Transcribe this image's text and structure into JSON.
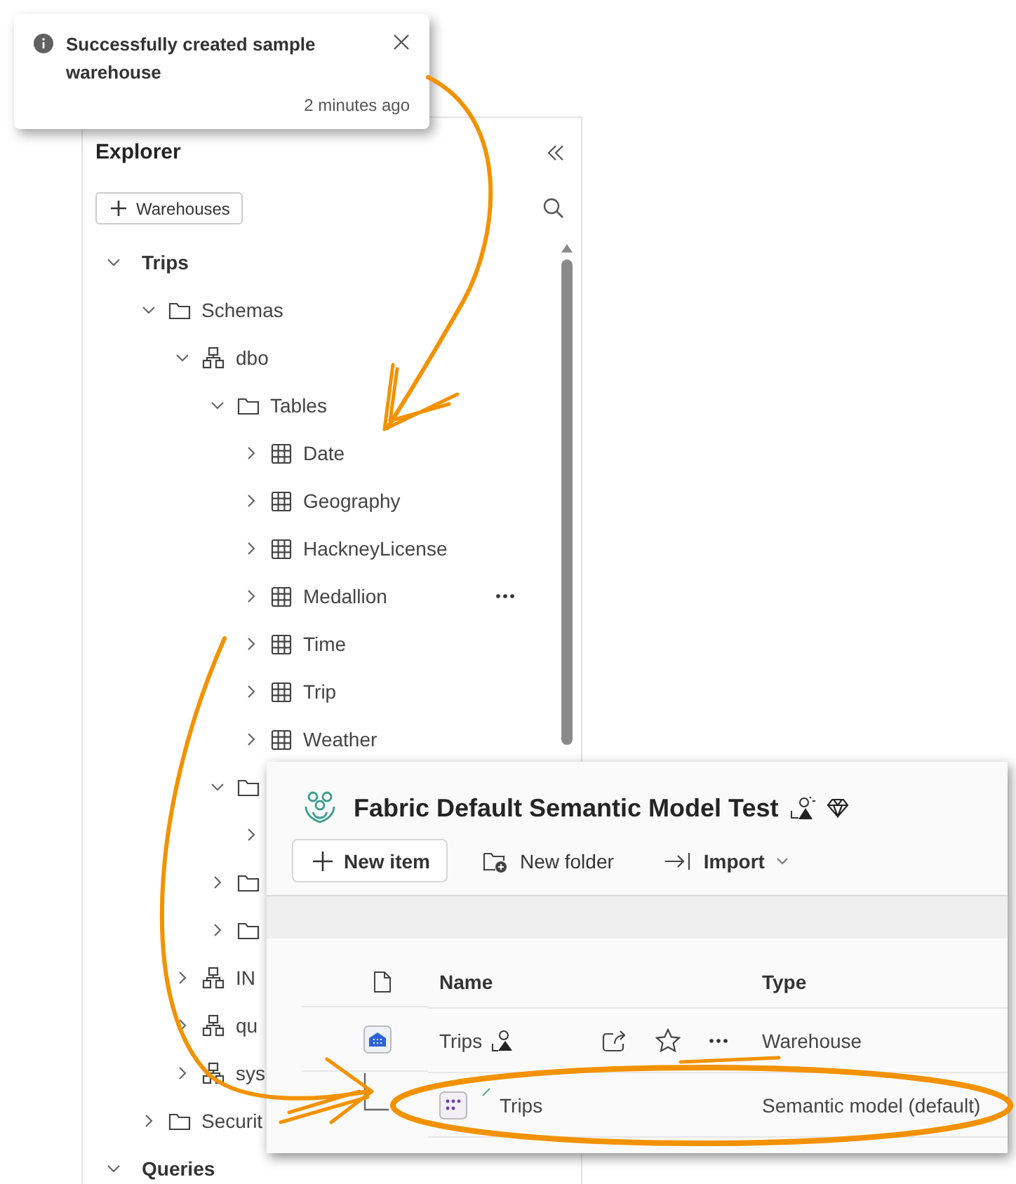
{
  "toast": {
    "message": "Successfully created sample warehouse",
    "time": "2 minutes ago"
  },
  "explorer": {
    "title": "Explorer",
    "add_button": "Warehouses",
    "tree": [
      {
        "label": "Trips",
        "kind": "root",
        "expanded": true,
        "children": [
          {
            "label": "Schemas",
            "kind": "folder",
            "expanded": true,
            "children": [
              {
                "label": "dbo",
                "kind": "schema",
                "expanded": true,
                "children": [
                  {
                    "label": "Tables",
                    "kind": "folder",
                    "expanded": true,
                    "children": [
                      {
                        "label": "Date",
                        "kind": "table",
                        "expanded": false,
                        "hovered": false
                      },
                      {
                        "label": "Geography",
                        "kind": "table",
                        "expanded": false,
                        "hovered": false
                      },
                      {
                        "label": "HackneyLicense",
                        "kind": "table",
                        "expanded": false,
                        "hovered": false
                      },
                      {
                        "label": "Medallion",
                        "kind": "table",
                        "expanded": false,
                        "hovered": true
                      },
                      {
                        "label": "Time",
                        "kind": "table",
                        "expanded": false,
                        "hovered": false
                      },
                      {
                        "label": "Trip",
                        "kind": "table",
                        "expanded": false,
                        "hovered": false
                      },
                      {
                        "label": "Weather",
                        "kind": "table",
                        "expanded": false,
                        "hovered": false
                      }
                    ]
                  },
                  {
                    "kind": "folder",
                    "expanded": true,
                    "children": [
                      {
                        "expanded": false
                      }
                    ]
                  },
                  {
                    "kind": "folder",
                    "expanded": false
                  },
                  {
                    "kind": "folder",
                    "expanded": false
                  }
                ]
              },
              {
                "label": "IN",
                "kind": "schema",
                "expanded": false
              },
              {
                "label": "qu",
                "kind": "schema",
                "expanded": false
              },
              {
                "label": "sys",
                "kind": "schema",
                "expanded": false
              }
            ]
          },
          {
            "label": "Securit",
            "kind": "folder",
            "expanded": false
          }
        ]
      },
      {
        "label": "Queries",
        "kind": "root",
        "expanded": true
      }
    ]
  },
  "workspace": {
    "title": "Fabric Default Semantic Model Test",
    "toolbar": [
      {
        "label": "New item",
        "kind": "new"
      },
      {
        "label": "New folder",
        "kind": "folder"
      },
      {
        "label": "Import",
        "kind": "import"
      }
    ],
    "columns": [
      "Name",
      "Type"
    ],
    "rows": [
      {
        "name": "Trips",
        "type": "Warehouse",
        "kind": "warehouse"
      },
      {
        "name": "Trips",
        "type": "Semantic model (default)",
        "kind": "semantic-model"
      }
    ]
  }
}
